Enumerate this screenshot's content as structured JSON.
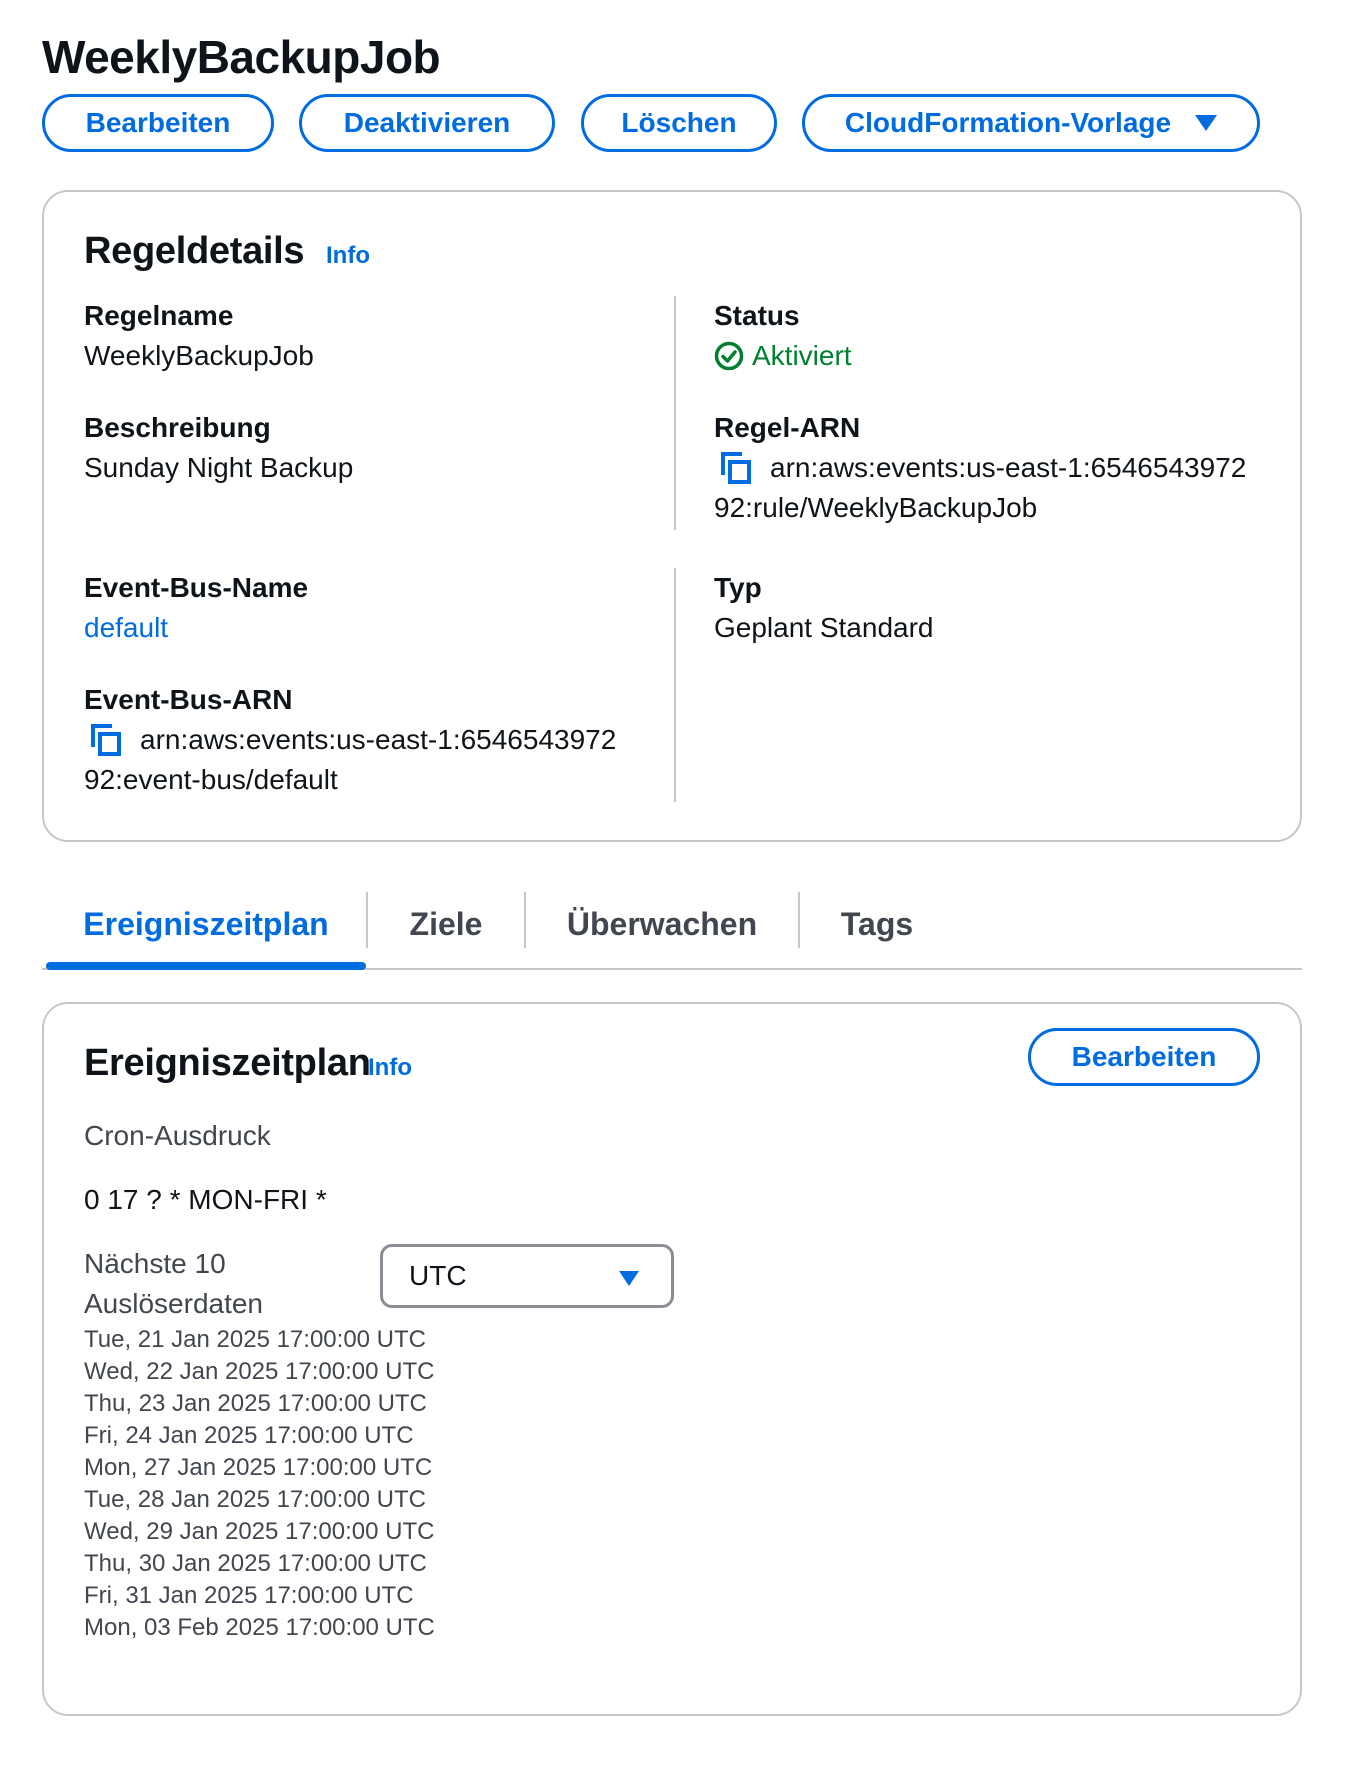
{
  "page": {
    "title": "WeeklyBackupJob"
  },
  "actions": {
    "edit": "Bearbeiten",
    "disable": "Deaktivieren",
    "delete": "Löschen",
    "cloudformation": "CloudFormation-Vorlage"
  },
  "rule_details": {
    "title": "Regeldetails",
    "info": "Info",
    "rule_name_label": "Regelname",
    "rule_name": "WeeklyBackupJob",
    "description_label": "Beschreibung",
    "description": "Sunday Night Backup",
    "status_label": "Status",
    "status": "Aktiviert",
    "rule_arn_label": "Regel-ARN",
    "rule_arn_line1": "arn:aws:events:us-east-1:6546543972",
    "rule_arn_line2": "92:rule/WeeklyBackupJob",
    "event_bus_name_label": "Event-Bus-Name",
    "event_bus_name": "default",
    "type_label": "Typ",
    "type": "Geplant Standard",
    "event_bus_arn_label": "Event-Bus-ARN",
    "event_bus_arn_line1": "arn:aws:events:us-east-1:6546543972",
    "event_bus_arn_line2": "92:event-bus/default"
  },
  "tabs": [
    {
      "label": "Ereigniszeitplan",
      "active": true
    },
    {
      "label": "Ziele",
      "active": false
    },
    {
      "label": "Überwachen",
      "active": false
    },
    {
      "label": "Tags",
      "active": false
    }
  ],
  "schedule": {
    "title": "Ereigniszeitplan",
    "info": "Info",
    "edit": "Bearbeiten",
    "cron_label": "Cron-Ausdruck",
    "cron_value": "0 17 ? * MON-FRI *",
    "next_label_line1": "Nächste 10",
    "next_label_line2": "Auslöserdaten",
    "timezone": "UTC",
    "dates": [
      "Tue, 21 Jan 2025 17:00:00 UTC",
      "Wed, 22 Jan 2025 17:00:00 UTC",
      "Thu, 23 Jan 2025 17:00:00 UTC",
      "Fri, 24 Jan 2025 17:00:00 UTC",
      "Mon, 27 Jan 2025 17:00:00 UTC",
      "Tue, 28 Jan 2025 17:00:00 UTC",
      "Wed, 29 Jan 2025 17:00:00 UTC",
      "Thu, 30 Jan 2025 17:00:00 UTC",
      "Fri, 31 Jan 2025 17:00:00 UTC",
      "Mon, 03 Feb 2025 17:00:00 UTC"
    ]
  },
  "colors": {
    "accent": "#006ce0",
    "success": "#00802f",
    "border": "#c6c6cd",
    "text": "#0f141a",
    "secondary_text": "#424650"
  },
  "icons": {
    "status": "check-circle-icon",
    "copy": "copy-icon",
    "dropdown": "caret-down-icon"
  }
}
